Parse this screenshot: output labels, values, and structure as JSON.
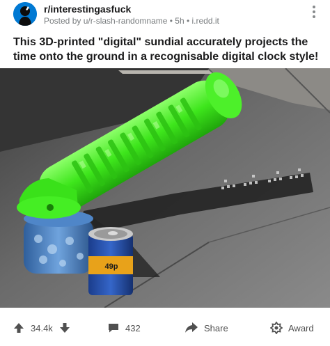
{
  "post": {
    "subreddit": "r/interestingasfuck",
    "meta": "Posted by u/r-slash-randomname • 5h • i.redd.it",
    "title": "This 3D-printed \"digital\" sundial accurately projects the time onto the ground in a recognisable digital clock style!",
    "image_alt": "Green 3D-printed digital sundial resting on a jar and a can, casting a shadow that reads the time",
    "can_text": "49p"
  },
  "actions": {
    "upvotes": "34.4k",
    "comments": "432",
    "share_label": "Share",
    "award_label": "Award"
  },
  "icons": {
    "upvote": "arrow-up-icon",
    "downvote": "arrow-down-icon",
    "comments": "comment-icon",
    "share": "share-icon",
    "award": "award-icon",
    "more": "more-vertical-icon"
  },
  "colors": {
    "avatar_bg": "#0079d3",
    "sundial_green": "#39e61a",
    "text_dark": "#1a1a1b",
    "text_meta": "#787c7e",
    "action_text": "#505050"
  }
}
